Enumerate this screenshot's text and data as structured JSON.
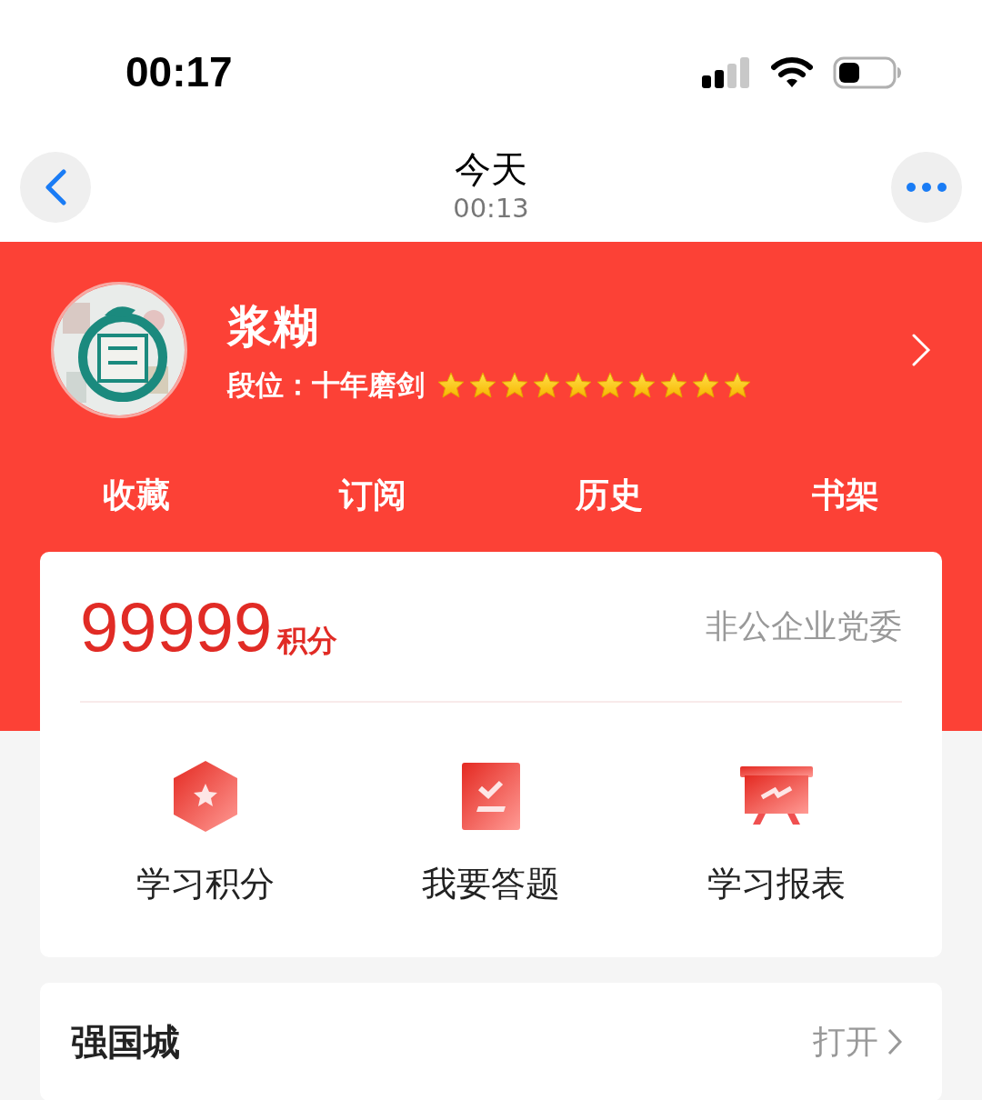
{
  "status_bar": {
    "time": "00:17"
  },
  "header": {
    "title": "今天",
    "subtitle": "00:13"
  },
  "profile": {
    "name": "浆糊",
    "rank_label": "段位：十年磨剑",
    "stars": 10
  },
  "shortcuts": [
    {
      "label": "收藏"
    },
    {
      "label": "订阅"
    },
    {
      "label": "历史"
    },
    {
      "label": "书架"
    }
  ],
  "score_card": {
    "points": "99999",
    "points_unit": "积分",
    "organization": "非公企业党委",
    "actions": [
      {
        "kind": "badge",
        "label": "学习积分"
      },
      {
        "kind": "quiz",
        "label": "我要答题"
      },
      {
        "kind": "report",
        "label": "学习报表"
      }
    ]
  },
  "city_card": {
    "title": "强国城",
    "action": "打开"
  }
}
